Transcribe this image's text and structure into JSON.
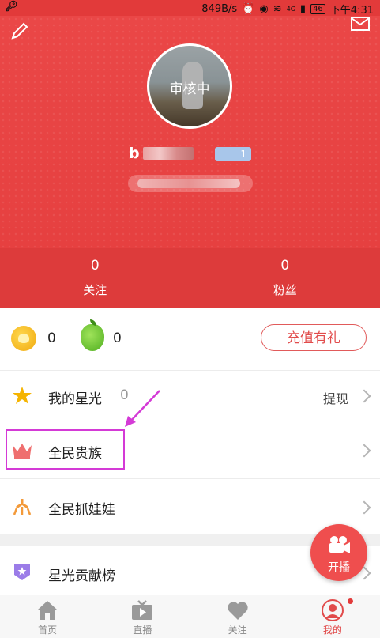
{
  "status_bar": {
    "speed": "849B/s",
    "battery": "46",
    "time": "下午4:31",
    "network": "4G"
  },
  "profile": {
    "avatar_status": "审核中",
    "username_prefix": "b",
    "level": "1"
  },
  "stats": [
    {
      "value": "0",
      "label": "关注"
    },
    {
      "value": "0",
      "label": "粉丝"
    }
  ],
  "wallet": {
    "coins": "0",
    "beans": "0",
    "recharge_label": "充值有礼"
  },
  "menu": [
    {
      "title": "我的星光",
      "count": "0",
      "extra": "提现"
    },
    {
      "title": "全民贵族"
    },
    {
      "title": "全民抓娃娃"
    },
    {
      "title": "星光贡献榜"
    }
  ],
  "fab": {
    "label": "开播"
  },
  "tabs": [
    {
      "label": "首页",
      "icon": "home-icon"
    },
    {
      "label": "直播",
      "icon": "tv-icon"
    },
    {
      "label": "关注",
      "icon": "heart-icon"
    },
    {
      "label": "我的",
      "icon": "profile-icon",
      "active": true
    }
  ],
  "colors": {
    "brand_red": "#e64040",
    "highlight": "#d43ad6"
  }
}
